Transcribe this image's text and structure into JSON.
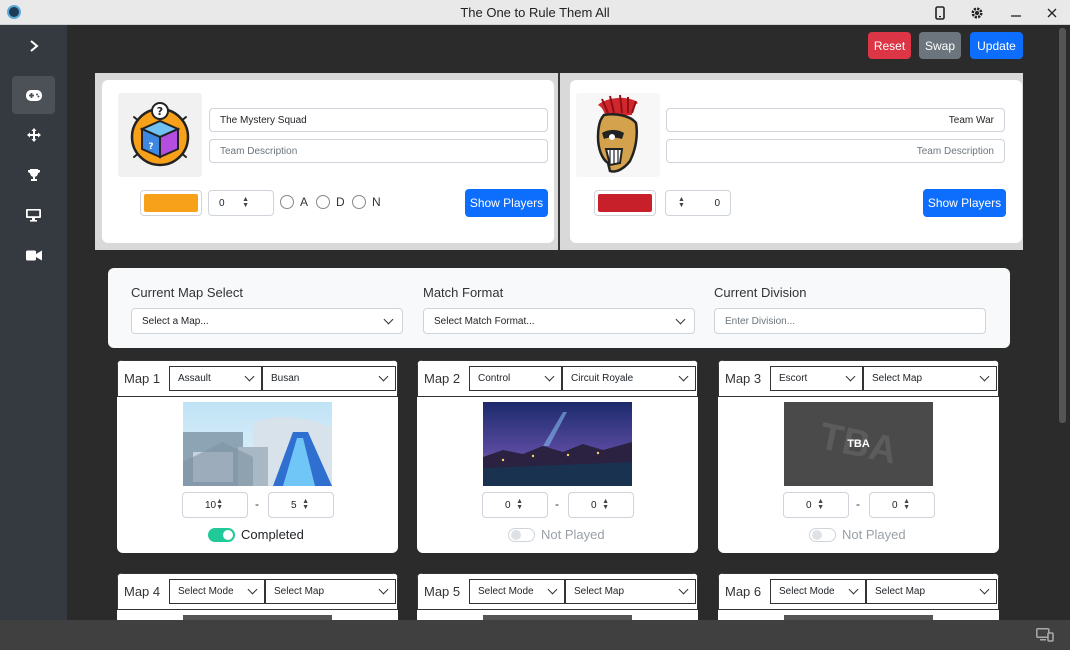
{
  "window": {
    "title": "The One to Rule Them All"
  },
  "toolbar": {
    "reset": "Reset",
    "swap": "Swap",
    "update": "Update"
  },
  "team1": {
    "name": "The Mystery Squad",
    "description_placeholder": "Team Description",
    "color": "#f7a01a",
    "score": "0",
    "radio_options": [
      "A",
      "D",
      "N"
    ],
    "show_players": "Show Players"
  },
  "team2": {
    "name": "Team War",
    "description_placeholder": "Team Description",
    "color": "#c8202a",
    "score": "0",
    "show_players": "Show Players"
  },
  "settings": {
    "map_label": "Current Map Select",
    "map_placeholder": "Select a Map...",
    "format_label": "Match Format",
    "format_placeholder": "Select Match Format...",
    "division_label": "Current Division",
    "division_placeholder": "Enter Division..."
  },
  "maps": [
    {
      "label": "Map 1",
      "mode": "Assault",
      "map": "Busan",
      "score1": "10",
      "score2": "5",
      "status": "Completed",
      "completed": true,
      "image": "busan-map-image"
    },
    {
      "label": "Map 2",
      "mode": "Control",
      "map": "Circuit Royale",
      "score1": "0",
      "score2": "0",
      "status": "Not Played",
      "completed": false,
      "image": "circuit-royale-map-image"
    },
    {
      "label": "Map 3",
      "mode": "Escort",
      "map": "Select Map",
      "score1": "0",
      "score2": "0",
      "status": "Not Played",
      "completed": false,
      "image": "tba-placeholder-image",
      "tba": "TBA"
    },
    {
      "label": "Map 4",
      "mode": "Select Mode",
      "map": "Select Map"
    },
    {
      "label": "Map 5",
      "mode": "Select Mode",
      "map": "Select Map"
    },
    {
      "label": "Map 6",
      "mode": "Select Mode",
      "map": "Select Map"
    }
  ],
  "colors": {
    "reset": "#dc3545",
    "swap": "#6c757d",
    "primary": "#0d6efd",
    "toggle_on": "#20c997"
  }
}
